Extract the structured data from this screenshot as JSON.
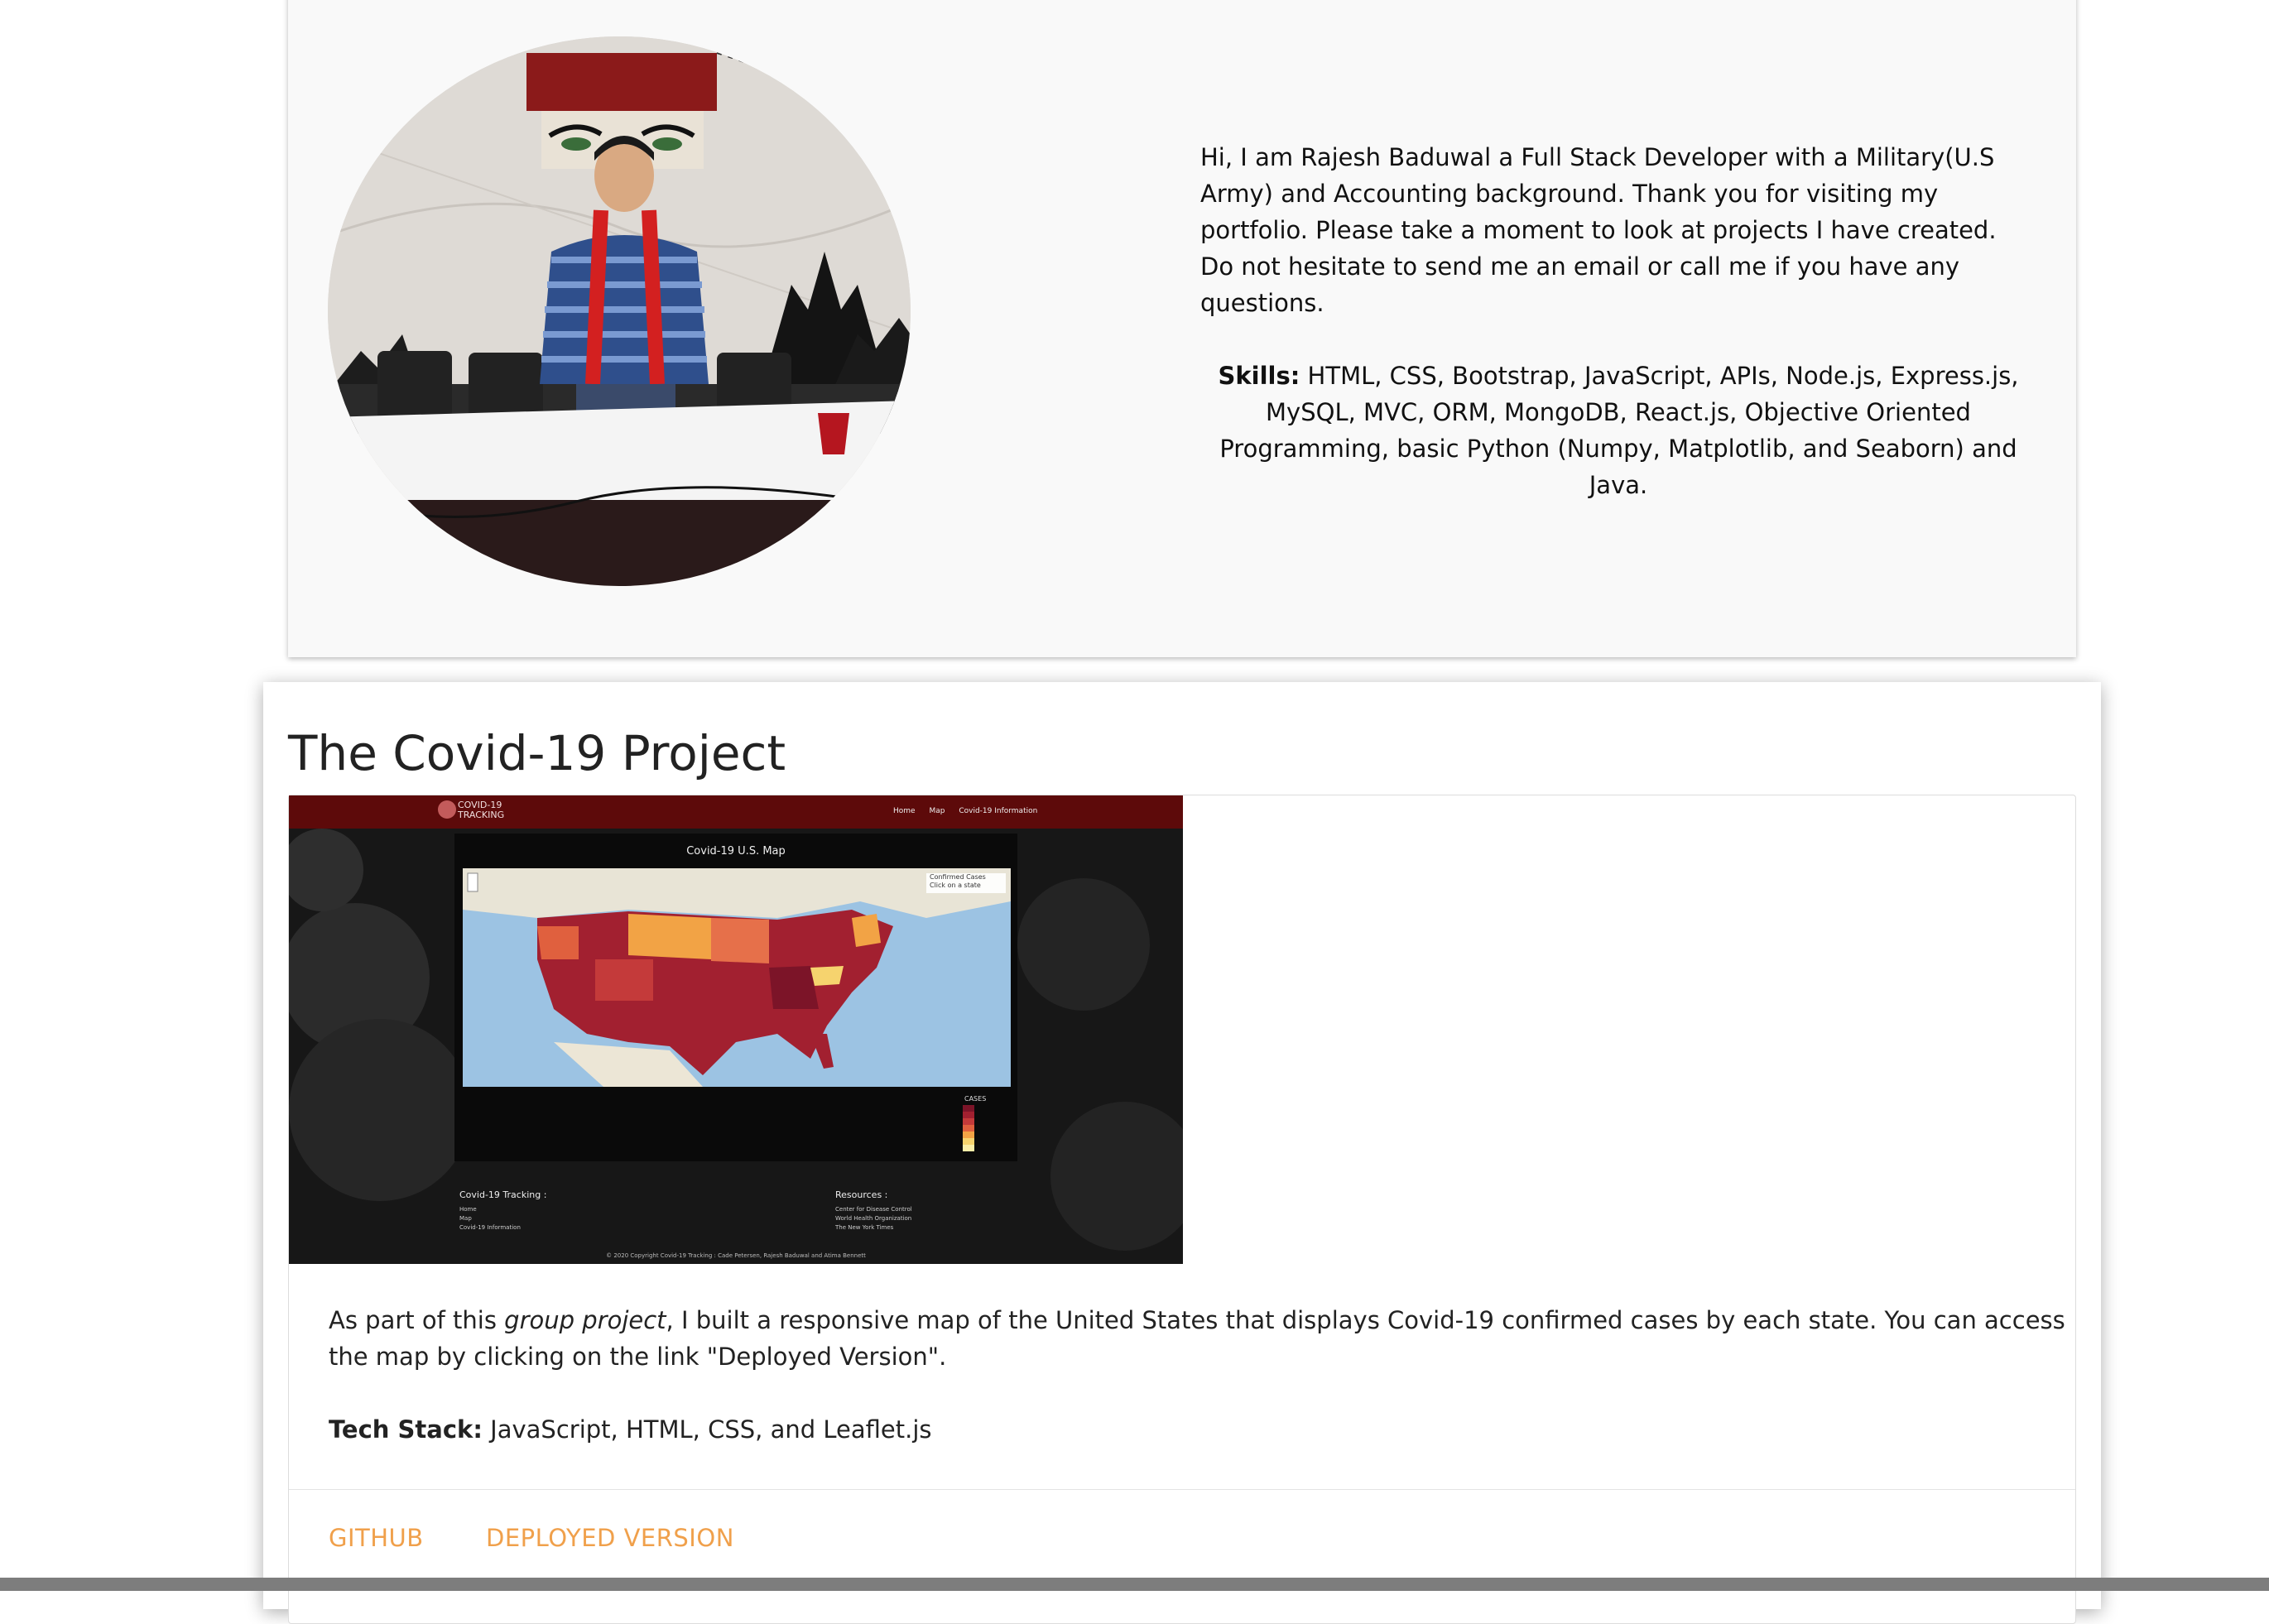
{
  "about": {
    "intro": "Hi, I am Rajesh Baduwal a Full Stack Developer with a Military(U.S Army) and Accounting background. Thank you for visiting my portfolio. Please take a moment to look at projects I have created. Do not hesitate to send me an email or call me if you have any questions.",
    "skills_label": "Skills:",
    "skills_text": " HTML, CSS, Bootstrap, JavaScript, APIs, Node.js, Express.js, MySQL, MVC, ORM, MongoDB, React.js, Objective Oriented Programming, basic Python (Numpy, Matplotlib, and Seaborn) and Java."
  },
  "project": {
    "title": "The Covid-19 Project",
    "screenshot": {
      "logo_line1": "COVID-19",
      "logo_line2": "TRACKING",
      "nav": [
        "Home",
        "Map",
        "Covid-19 Information"
      ],
      "map_title": "Covid-19 U.S. Map",
      "map_control": "Confirmed Cases",
      "map_control_sub": "Click on a state",
      "legend_title": "CASES",
      "footer_left_title": "Covid-19 Tracking :",
      "footer_left_items": [
        "Home",
        "Map",
        "Covid-19 Information"
      ],
      "footer_right_title": "Resources :",
      "footer_right_items": [
        "Center for Disease Control",
        "World Health Organization",
        "The New York Times"
      ],
      "copyright": "© 2020 Copyright Covid-19 Tracking : Cade Petersen, Rajesh Baduwal and Atima Bennett"
    },
    "desc_before": "As part of this ",
    "desc_em": "group project",
    "desc_after": ", I built a responsive map of the United States that displays Covid-19 confirmed cases by each state. You can access the map by clicking on the link \"Deployed Version\".",
    "tech_label": "Tech Stack:",
    "tech_text": " JavaScript, HTML, CSS, and Leaflet.js",
    "links": {
      "github": "GITHUB",
      "deployed": "DEPLOYED VERSION"
    }
  },
  "colors": {
    "link": "#f0a04b",
    "nav_dark_red": "#5d0a0a",
    "map_water": "#9cc3e3"
  }
}
